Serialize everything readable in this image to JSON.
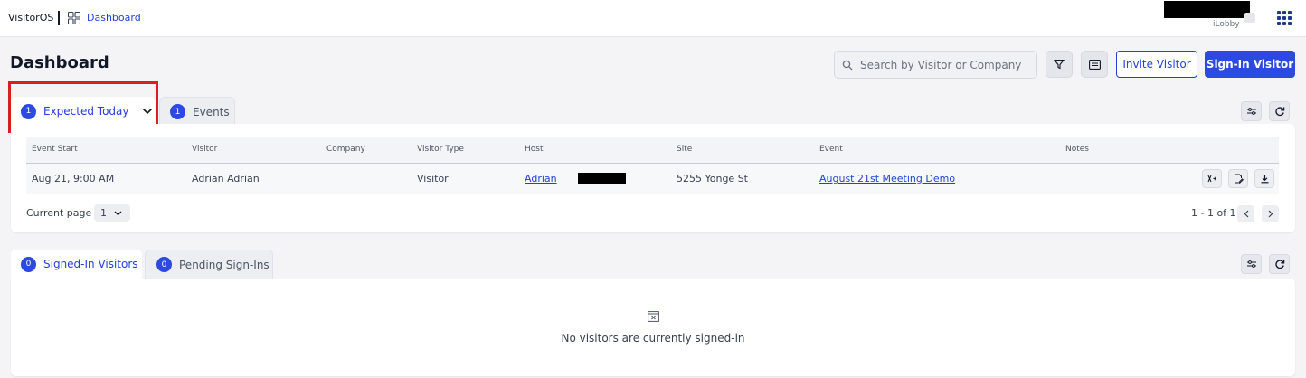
{
  "topbar": {
    "brand": "VisitorOS",
    "breadcrumb": "Dashboard",
    "org_name": "iLobby"
  },
  "header": {
    "title": "Dashboard",
    "search_placeholder": "Search by Visitor or Company",
    "invite_label": "Invite Visitor",
    "signin_label": "Sign-In Visitor"
  },
  "tabs_top": [
    {
      "count": "1",
      "label": "Expected Today"
    },
    {
      "count": "1",
      "label": "Events"
    }
  ],
  "table": {
    "columns": [
      "Event Start",
      "Visitor",
      "Company",
      "Visitor Type",
      "Host",
      "Site",
      "Event",
      "Notes"
    ],
    "rows": [
      {
        "event_start": "Aug 21, 9:00 AM",
        "visitor": "Adrian Adrian",
        "company": "",
        "visitor_type": "Visitor",
        "host": "Adrian",
        "site": "5255 Yonge St",
        "event": "August 21st Meeting Demo",
        "notes": ""
      }
    ],
    "current_page_label": "Current page",
    "current_page": "1",
    "range_label": "1 - 1 of 1"
  },
  "tabs_bottom": [
    {
      "count": "0",
      "label": "Signed-In Visitors"
    },
    {
      "count": "0",
      "label": "Pending Sign-Ins"
    }
  ],
  "empty_state": {
    "message": "No visitors are currently signed-in"
  },
  "colors": {
    "accent": "#2d4ae0",
    "link": "#2340d8",
    "highlight": "#d92020",
    "background": "#f4f4f7"
  }
}
